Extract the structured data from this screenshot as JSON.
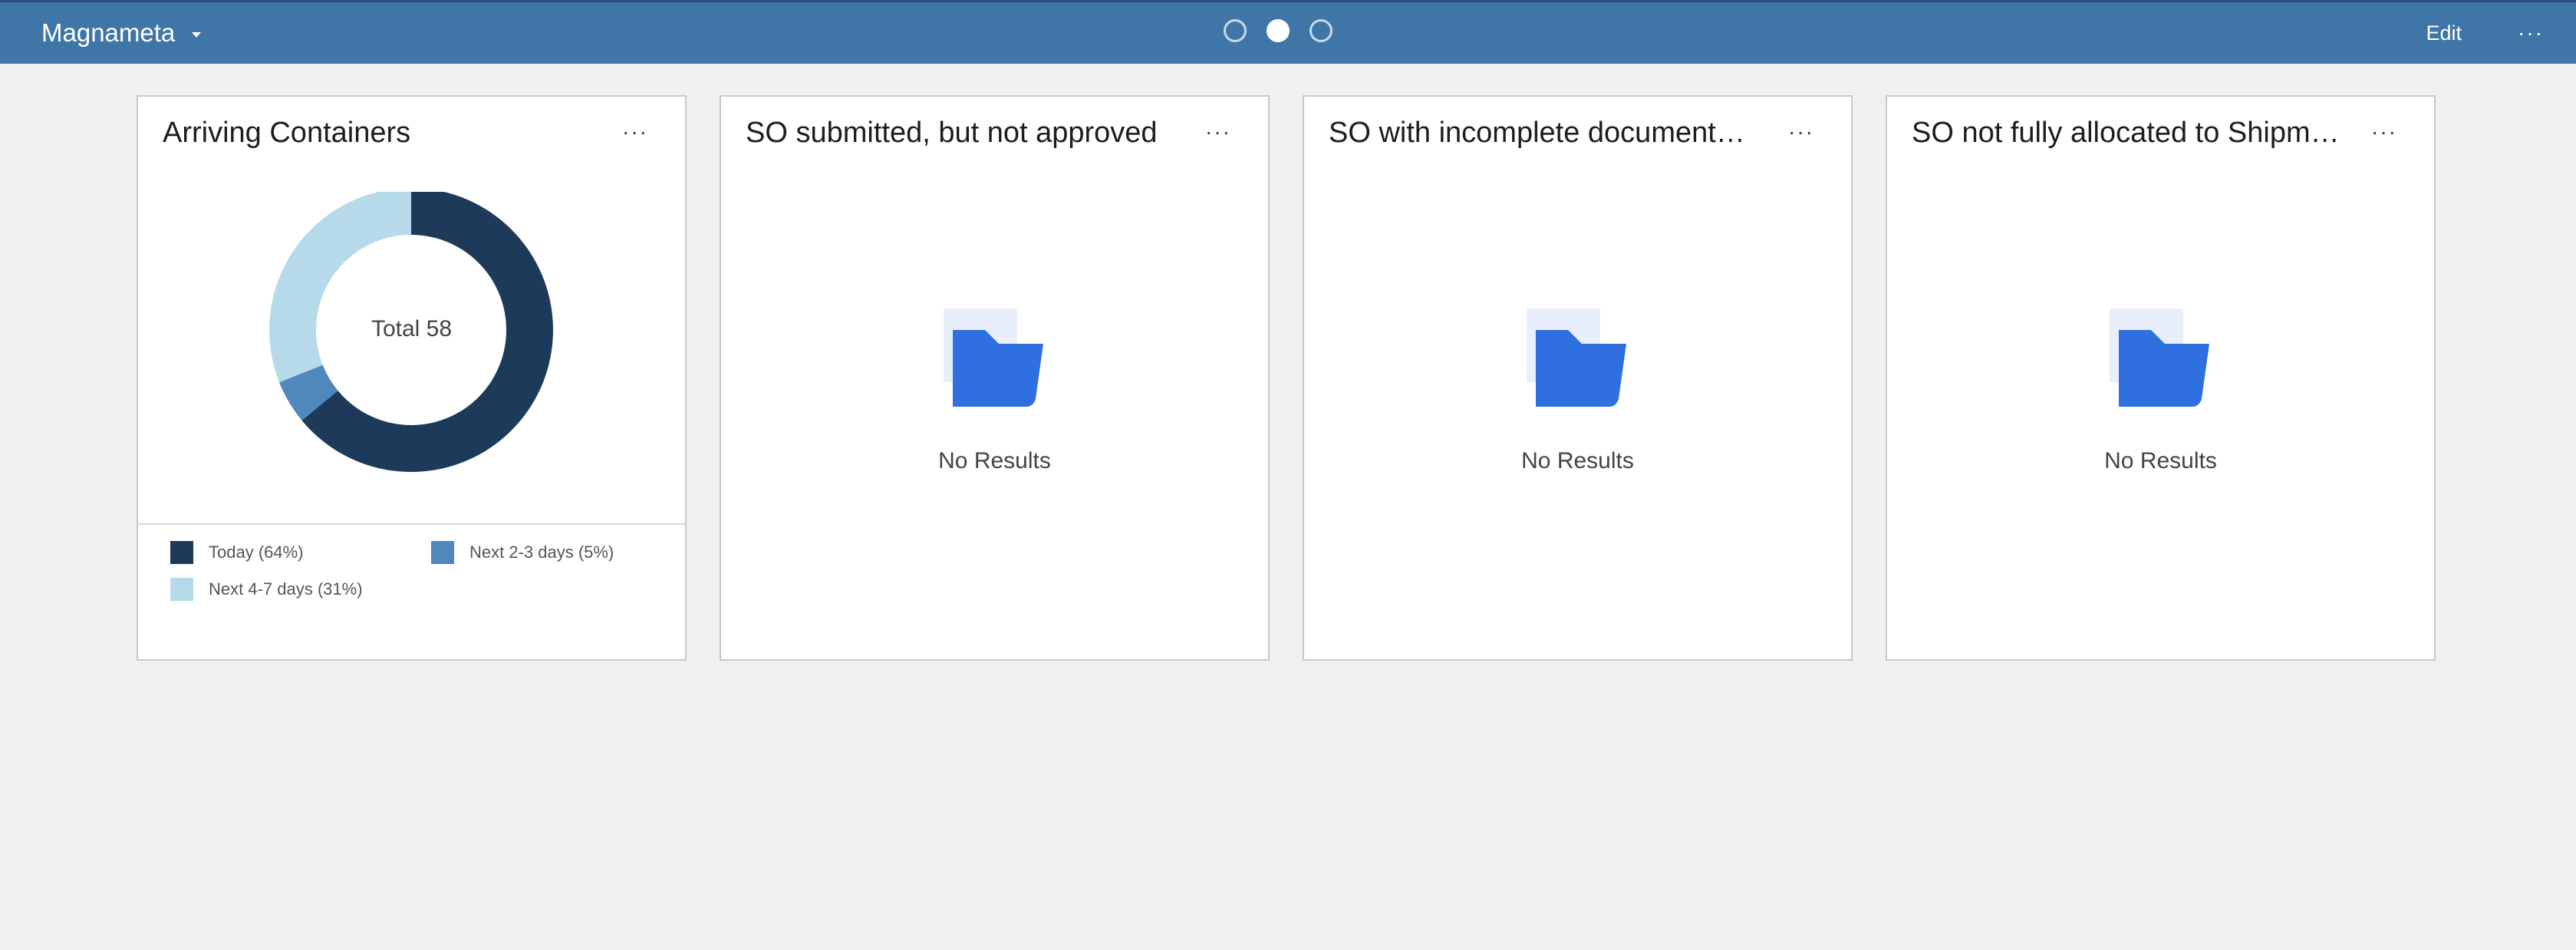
{
  "header": {
    "app_name": "Magnameta",
    "pages": [
      {
        "active": false
      },
      {
        "active": true
      },
      {
        "active": false
      }
    ],
    "edit_label": "Edit",
    "more_label": "···"
  },
  "cards": [
    {
      "title": "Arriving Containers",
      "more_label": "···",
      "total_label": "Total 58",
      "legend": [
        {
          "label": "Today (64%)",
          "color": "#1e3a5a"
        },
        {
          "label": "Next 2-3 days (5%)",
          "color": "#4f88bd"
        },
        {
          "label": "Next 4-7 days (31%)",
          "color": "#b6dae9"
        }
      ]
    },
    {
      "title": "SO submitted, but not approved",
      "more_label": "···",
      "empty_text": "No Results"
    },
    {
      "title": "SO with incomplete documentation",
      "more_label": "···",
      "empty_text": "No Results"
    },
    {
      "title": "SO not fully allocated to Shipments",
      "more_label": "···",
      "empty_text": "No Results"
    }
  ],
  "chart_data": {
    "type": "pie",
    "donut": true,
    "total": 58,
    "categories": [
      "Today",
      "Next 2-3 days",
      "Next 4-7 days"
    ],
    "values": [
      64,
      5,
      31
    ],
    "unit": "%",
    "colors": [
      "#1e3a5a",
      "#4f88bd",
      "#b6dae9"
    ],
    "legend_position": "bottom"
  },
  "colors": {
    "header_bg": "#3f76a7",
    "page_bg": "#f0f0f0",
    "folder_blue": "#2f6fe0",
    "folder_back": "#e8effb"
  },
  "icons": {
    "folder": "folder-icon",
    "more": "more-horizontal-icon",
    "dropdown": "chevron-down-icon"
  }
}
